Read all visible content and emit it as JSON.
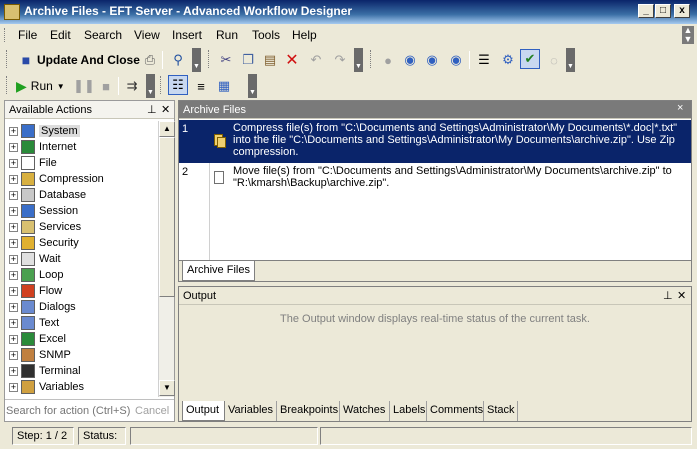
{
  "window": {
    "title": "Archive Files - EFT Server - Advanced Workflow Designer",
    "minimize": "_",
    "maximize": "□",
    "close": "x"
  },
  "menu": {
    "file": "File",
    "edit": "Edit",
    "search": "Search",
    "view": "View",
    "insert": "Insert",
    "run": "Run",
    "tools": "Tools",
    "help": "Help"
  },
  "toolbar": {
    "update_close": "Update And Close",
    "run": "Run"
  },
  "left_panel": {
    "title": "Available Actions",
    "search_placeholder": "Search for action (Ctrl+S)",
    "cancel": "Cancel",
    "items": [
      {
        "label": "System",
        "icon": "computer-icon",
        "color": "#3a6ec8"
      },
      {
        "label": "Internet",
        "icon": "globe-icon",
        "color": "#2a8a3a"
      },
      {
        "label": "File",
        "icon": "file-icon",
        "color": "#ffffff"
      },
      {
        "label": "Compression",
        "icon": "compression-icon",
        "color": "#d8b040"
      },
      {
        "label": "Database",
        "icon": "database-icon",
        "color": "#c8c8c8"
      },
      {
        "label": "Session",
        "icon": "session-icon",
        "color": "#3a6ec8"
      },
      {
        "label": "Services",
        "icon": "services-icon",
        "color": "#d8c070"
      },
      {
        "label": "Security",
        "icon": "security-icon",
        "color": "#e0b030"
      },
      {
        "label": "Wait",
        "icon": "wait-icon",
        "color": "#e0e0e0"
      },
      {
        "label": "Loop",
        "icon": "loop-icon",
        "color": "#4aa050"
      },
      {
        "label": "Flow",
        "icon": "flow-icon",
        "color": "#d04020"
      },
      {
        "label": "Dialogs",
        "icon": "dialogs-icon",
        "color": "#6a8ad0"
      },
      {
        "label": "Text",
        "icon": "text-icon",
        "color": "#6a8ad0"
      },
      {
        "label": "Excel",
        "icon": "excel-icon",
        "color": "#2a8a3a"
      },
      {
        "label": "SNMP",
        "icon": "snmp-icon",
        "color": "#c08040"
      },
      {
        "label": "Terminal",
        "icon": "terminal-icon",
        "color": "#303030"
      },
      {
        "label": "Variables",
        "icon": "variables-icon",
        "color": "#d0a040"
      }
    ]
  },
  "task_panel": {
    "title": "Archive Files",
    "close": "×",
    "tab": "Archive Files",
    "tasks": [
      {
        "num": "1",
        "text": "Compress file(s) from \"C:\\Documents and Settings\\Administrator\\My Documents\\*.doc|*.txt\" into the file \"C:\\Documents and Settings\\Administrator\\My Documents\\archive.zip\".  Use Zip compression."
      },
      {
        "num": "2",
        "text": "Move file(s) from \"C:\\Documents and Settings\\Administrator\\My Documents\\archive.zip\" to \"R:\\kmarsh\\Backup\\archive.zip\"."
      }
    ]
  },
  "output_panel": {
    "title": "Output",
    "message": "The Output window displays real-time status of the current task.",
    "tabs": [
      "Output",
      "Variables",
      "Breakpoints",
      "Watches",
      "Labels",
      "Comments",
      "Stack"
    ]
  },
  "statusbar": {
    "step": "Step: 1 / 2",
    "status": "Status:"
  }
}
